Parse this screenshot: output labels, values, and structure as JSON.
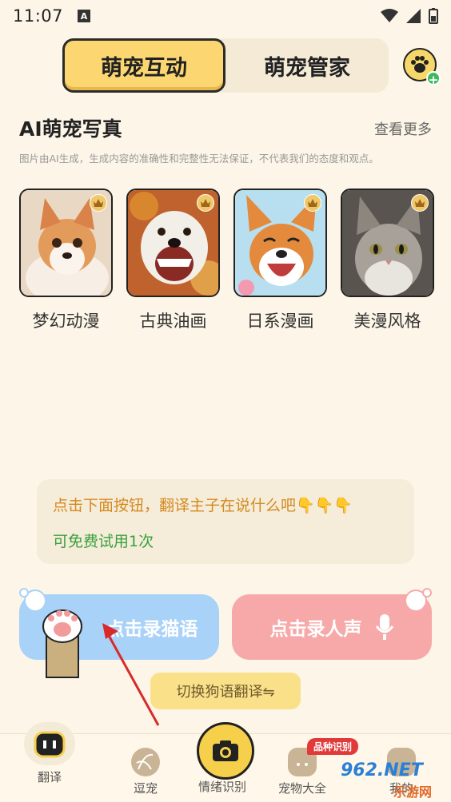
{
  "status_bar": {
    "time": "11:07"
  },
  "segments": {
    "tab1": "萌宠互动",
    "tab2": "萌宠管家"
  },
  "section": {
    "title": "AI萌宠写真",
    "more": "查看更多",
    "disclaimer": "图片由AI生成，生成内容的准确性和完整性无法保证，不代表我们的态度和观点。"
  },
  "styles": [
    {
      "label": "梦幻动漫"
    },
    {
      "label": "古典油画"
    },
    {
      "label": "日系漫画"
    },
    {
      "label": "美漫风格"
    }
  ],
  "bubble": {
    "line1": "点击下面按钮，翻译主子在说什么吧👇👇👇",
    "line2": "可免费试用1次"
  },
  "record": {
    "cat_label": "点击录猫语",
    "human_label": "点击录人声"
  },
  "switch_label": "切换狗语翻译⇋",
  "tabs": {
    "translate": "翻译",
    "tease": "逗宠",
    "emotion": "情绪识别",
    "encyclopedia": "宠物大全",
    "mine": "我的",
    "badge": "品种识别"
  },
  "watermark": {
    "brand": "962.NET",
    "sub": "乐游网"
  },
  "colors": {
    "accent": "#fcd771",
    "cat_button": "#a9d2f8",
    "human_button": "#f7a9a9",
    "trial_text": "#37a13d",
    "prompt_text": "#d48a1e"
  }
}
